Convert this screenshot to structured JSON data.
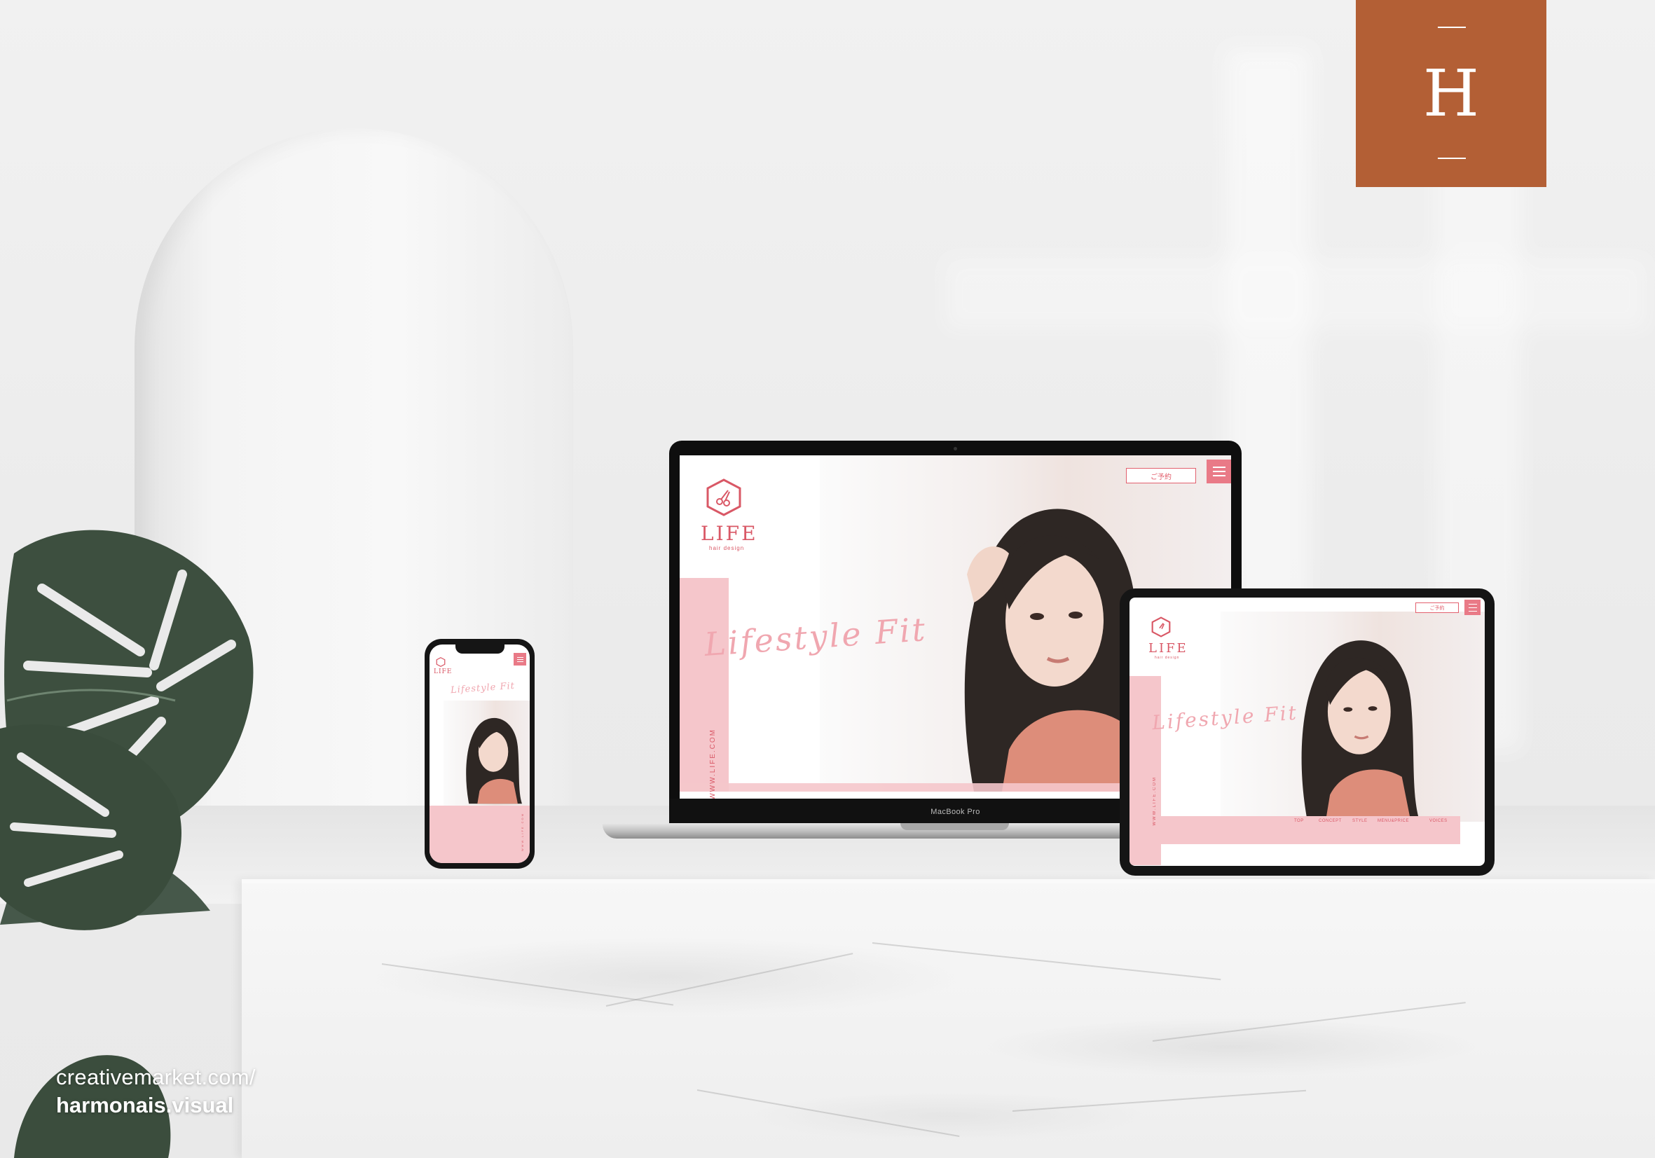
{
  "brand": {
    "letter": "H",
    "color": "#b35f35"
  },
  "credit": {
    "line1": "creativemarket.com/",
    "line2": "harmonais.visual"
  },
  "website": {
    "logo_word": "LIFE",
    "logo_sub": "hair design",
    "tagline": "Lifestyle Fit",
    "url": "WWW.LIFE.COM",
    "reserve_label": "ご予約",
    "nav": [
      "TOP",
      "CONCEPT",
      "STYLE",
      "MENU&PRICE",
      "VOICES"
    ],
    "accent": "#e2606e",
    "panel_color": "#f5c6cb"
  },
  "laptop": {
    "model_label": "MacBook Pro"
  },
  "icons": {
    "menu": "hamburger-menu-icon",
    "logo": "scissors-hexagon-icon"
  }
}
